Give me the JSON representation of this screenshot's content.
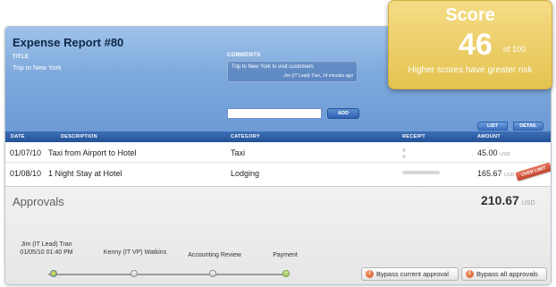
{
  "report": {
    "title": "Expense Report #80",
    "title_label": "TITLE",
    "title_value": "Trip to New York",
    "comments_label": "COMMENTS",
    "comment_text": "Trip to New York to visit customers",
    "comment_author": "-Jim (IT Lead) Tran, 14 minutes ago",
    "comment_input_placeholder": "",
    "add_label": "ADD",
    "view_list_label": "LIST",
    "view_detail_label": "DETAIL"
  },
  "table": {
    "headers": {
      "date": "DATE",
      "description": "DESCRIPTION",
      "category": "CATEGORY",
      "receipt": "RECEIPT",
      "amount": "AMOUNT"
    },
    "rows": [
      {
        "date": "01/07/10",
        "description": "Taxi from Airport to Hotel",
        "category": "Taxi",
        "amount": "45.00",
        "currency": "USD"
      },
      {
        "date": "01/08/10",
        "description": "1 Night Stay at Hotel",
        "category": "Lodging",
        "amount": "165.67",
        "currency": "USD",
        "flag": "OVER LIMIT"
      }
    ]
  },
  "approvals": {
    "title": "Approvals",
    "total": "210.67",
    "total_currency": "USD",
    "steps": [
      {
        "name": "Jim (IT Lead) Tran",
        "time": "01/05/10 01:40 PM"
      },
      {
        "name": "Kenny (IT VP) Watkins"
      },
      {
        "name": "Accounting Review"
      },
      {
        "name": "Payment"
      }
    ],
    "bypass_current_label": "Bypass current approval",
    "bypass_all_label": "Bypass all approvals"
  },
  "score": {
    "label": "Score",
    "value": "46",
    "of": "of 100",
    "note": "Higher scores have greater risk"
  },
  "colors": {
    "header_blue": "#7ea9dc",
    "table_header_blue": "#245196",
    "score_gold": "#e4c350",
    "over_limit_red": "#c2452f"
  },
  "icons": {
    "bypass": "warning-circle-icon"
  }
}
